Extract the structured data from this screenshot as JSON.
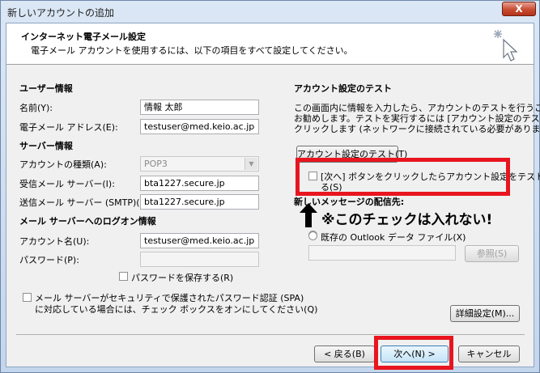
{
  "window": {
    "title": "新しいアカウントの追加",
    "close_label": "X"
  },
  "header": {
    "title": "インターネット電子メール設定",
    "subtitle": "電子メール アカウントを使用するには、以下の項目をすべて設定してください。"
  },
  "user_info": {
    "heading": "ユーザー情報",
    "name_label": "名前(Y):",
    "name_value": "情報 太郎",
    "email_label": "電子メール アドレス(E):",
    "email_value": "testuser@med.keio.ac.jp"
  },
  "server_info": {
    "heading": "サーバー情報",
    "account_type_label": "アカウントの種類(A):",
    "account_type_value": "POP3",
    "incoming_label": "受信メール サーバー(I):",
    "incoming_value": "bta1227.secure.jp",
    "outgoing_label": "送信メール サーバー (SMTP)(O):",
    "outgoing_value": "bta1227.secure.jp"
  },
  "logon_info": {
    "heading": "メール サーバーへのログオン情報",
    "account_name_label": "アカウント名(U):",
    "account_name_value": "testuser@med.keio.ac.jp",
    "password_label": "パスワード(P):",
    "password_value": "",
    "remember_password_label": "パスワードを保存する(R)",
    "spa_label_line1": "メール サーバーがセキュリティで保護されたパスワード認証 (SPA)",
    "spa_label_line2": "に対応している場合には、チェック ボックスをオンにしてください(Q)"
  },
  "test": {
    "heading": "アカウント設定のテスト",
    "description_line1": "この画面内に情報を入力したら、アカウントのテストを行うことを",
    "description_line2": "お勧めします。テストを実行するには [アカウント設定のテスト] を",
    "description_line3": "クリックします (ネットワークに接続されている必要があります)。",
    "test_button_label": "アカウント設定のテスト(T)",
    "auto_test_label_line1": "[次へ] ボタンをクリックしたらアカウント設定をテストす",
    "auto_test_label_line2": "る(S)",
    "deliver_heading": "新しいメッセージの配信先:",
    "existing_pst_label": "既存の Outlook データ ファイル(X)",
    "browse_label": "参照(S)"
  },
  "annotation": {
    "note_text": "※このチェックは入れない!"
  },
  "footer": {
    "details_label": "詳細設定(M)...",
    "back_label": "< 戻る(B)",
    "next_label": "次へ(N) >",
    "cancel_label": "キャンセル"
  },
  "colors": {
    "highlight_red": "#e8151f",
    "window_frame": "#c4d6ec"
  }
}
